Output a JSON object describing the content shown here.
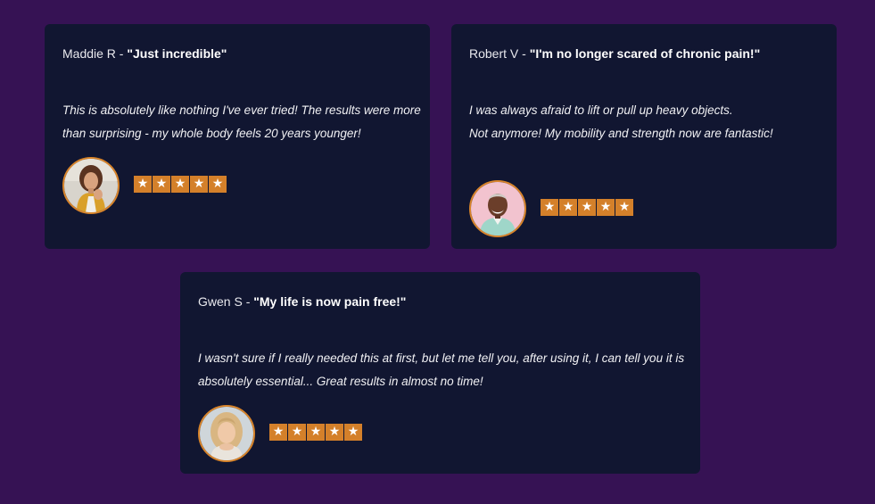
{
  "colors": {
    "page_background": "#361254",
    "card_background": "#111631",
    "star_background": "#d4802a",
    "avatar_border": "#d8842a"
  },
  "icons": {
    "star": "star-icon",
    "avatar": "avatar-photo"
  },
  "testimonials": [
    {
      "author": "Maddie R - ",
      "quote": "\"Just incredible\"",
      "lines": [
        "This is absolutely like nothing I've ever tried! The results were more",
        "than surprising - my whole body feels 20 years younger!"
      ],
      "rating": 5,
      "star_glyph": "★"
    },
    {
      "author": "Robert V - ",
      "quote": "\"I'm no longer scared of chronic pain!\"",
      "lines": [
        "I was always afraid to lift or pull up heavy objects.",
        "Not anymore! My mobility and strength now are fantastic!"
      ],
      "rating": 5,
      "star_glyph": "★"
    },
    {
      "author": "Gwen S - ",
      "quote": "\"My life is now pain free!\"",
      "lines": [
        "I wasn't sure if I really needed this at first, but let me tell you, after using it, I can tell you it is",
        "absolutely essential... Great results in almost no time!"
      ],
      "rating": 5,
      "star_glyph": "★"
    }
  ]
}
